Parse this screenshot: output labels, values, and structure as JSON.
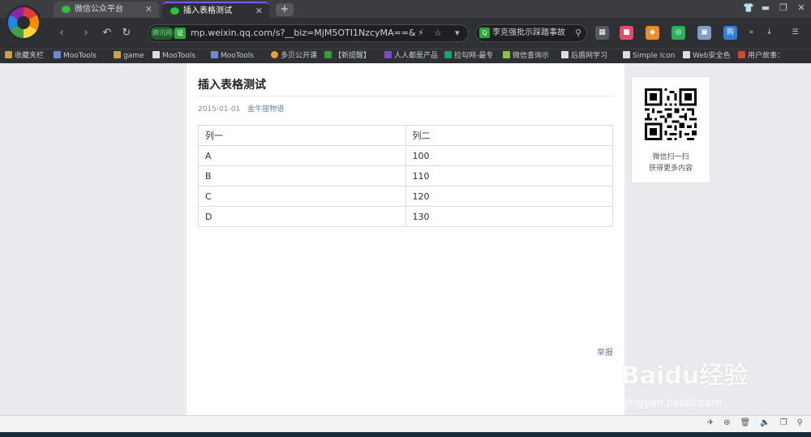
{
  "browser": {
    "tabs": [
      {
        "label": "微信公众平台",
        "active": false
      },
      {
        "label": "插入表格测试",
        "active": true
      }
    ],
    "new_tab": "+",
    "address": {
      "security_label": "腾讯网",
      "security_badge": "证",
      "url": "mp.weixin.qq.com/s?__biz=MjM5OTI1NzcyMA==&"
    },
    "search": {
      "engine_badge": "Q",
      "text": "李克强批示踩踏事故"
    },
    "bookmarks": [
      {
        "label": "收藏夹栏",
        "icon": "folder-icon"
      },
      {
        "label": "MooTools",
        "icon": "wrench-icon"
      },
      {
        "label": "game",
        "icon": "folder-icon"
      },
      {
        "label": "MooTools",
        "icon": "page-icon"
      },
      {
        "label": "MooTools",
        "icon": "wrench-icon"
      },
      {
        "label": "多贝公开课",
        "icon": "globe-icon"
      },
      {
        "label": "【新提醒】",
        "icon": "site-icon"
      },
      {
        "label": "人人都是产品",
        "icon": "m-icon"
      },
      {
        "label": "拉勾网-最专",
        "icon": "l-icon"
      },
      {
        "label": "微信查询示",
        "icon": "site-icon"
      },
      {
        "label": "后盾网学习",
        "icon": "page-icon"
      },
      {
        "label": "Simple Icon",
        "icon": "page-icon"
      },
      {
        "label": "Web安全色",
        "icon": "page-icon"
      },
      {
        "label": "用户故事：",
        "icon": "site-icon"
      }
    ]
  },
  "article": {
    "title": "插入表格测试",
    "date": "2015-01-01",
    "author": "金牛座物语",
    "table": {
      "header": [
        "列一",
        "列二"
      ],
      "rows": [
        [
          "A",
          "100"
        ],
        [
          "B",
          "110"
        ],
        [
          "C",
          "120"
        ],
        [
          "D",
          "130"
        ]
      ]
    },
    "report_link": "举报"
  },
  "sidebar": {
    "qr_caption_line1": "微信扫一扫",
    "qr_caption_line2": "获得更多内容"
  },
  "watermark": {
    "brand": "Baidu经验",
    "url": "jingyan.baidu.com"
  }
}
